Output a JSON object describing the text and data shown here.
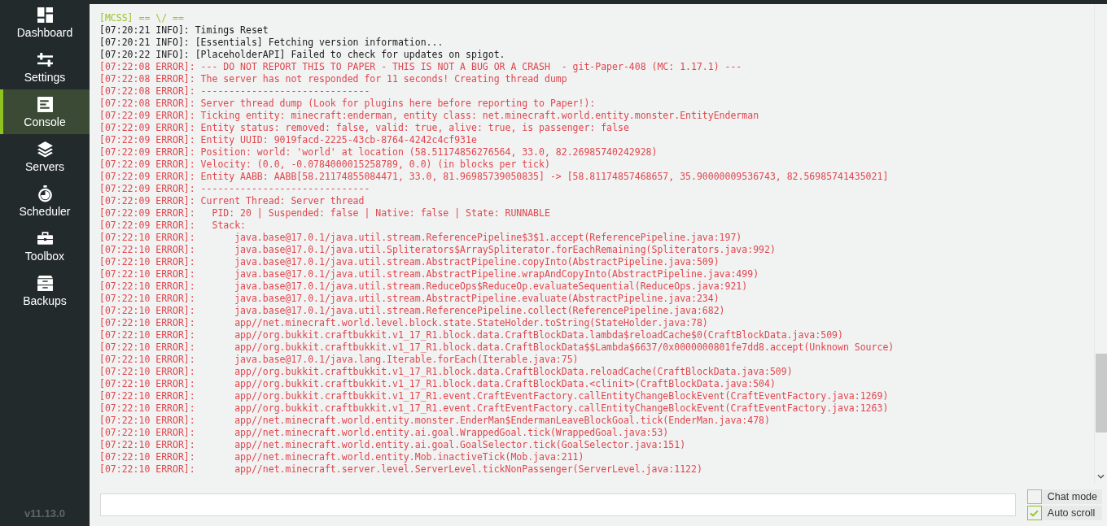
{
  "sidebar": {
    "items": [
      {
        "label": "Dashboard",
        "selected": false
      },
      {
        "label": "Settings",
        "selected": false
      },
      {
        "label": "Console",
        "selected": true
      },
      {
        "label": "Servers",
        "selected": false
      },
      {
        "label": "Scheduler",
        "selected": false
      },
      {
        "label": "Toolbox",
        "selected": false
      },
      {
        "label": "Backups",
        "selected": false
      }
    ],
    "version": "v11.13.0"
  },
  "console": {
    "lines": [
      {
        "kind": "mcss",
        "text": "[MCSS] == \\/ =="
      },
      {
        "kind": "info",
        "text": "[07:20:21 INFO]: Timings Reset"
      },
      {
        "kind": "info",
        "text": "[07:20:21 INFO]: [Essentials] Fetching version information..."
      },
      {
        "kind": "info",
        "text": "[07:20:22 INFO]: [PlaceholderAPI] Failed to check for updates on spigot."
      },
      {
        "kind": "error",
        "text": "[07:22:08 ERROR]: --- DO NOT REPORT THIS TO PAPER - THIS IS NOT A BUG OR A CRASH  - git-Paper-408 (MC: 1.17.1) ---"
      },
      {
        "kind": "error",
        "text": "[07:22:08 ERROR]: The server has not responded for 11 seconds! Creating thread dump"
      },
      {
        "kind": "error",
        "text": "[07:22:08 ERROR]: ------------------------------"
      },
      {
        "kind": "error",
        "text": "[07:22:08 ERROR]: Server thread dump (Look for plugins here before reporting to Paper!):"
      },
      {
        "kind": "error",
        "text": "[07:22:09 ERROR]: Ticking entity: minecraft:enderman, entity class: net.minecraft.world.entity.monster.EntityEnderman"
      },
      {
        "kind": "error",
        "text": "[07:22:09 ERROR]: Entity status: removed: false, valid: true, alive: true, is passenger: false"
      },
      {
        "kind": "error",
        "text": "[07:22:09 ERROR]: Entity UUID: 9019facd-2225-43cb-8764-4242c4cf931e"
      },
      {
        "kind": "error",
        "text": "[07:22:09 ERROR]: Position: world: 'world' at location (58.51174856276564, 33.0, 82.26985740242928)"
      },
      {
        "kind": "error",
        "text": "[07:22:09 ERROR]: Velocity: (0.0, -0.0784000015258789, 0.0) (in blocks per tick)"
      },
      {
        "kind": "error",
        "text": "[07:22:09 ERROR]: Entity AABB: AABB[58.21174855084471, 33.0, 81.96985739050835] -> [58.81174857468657, 35.90000009536743, 82.56985741435021]"
      },
      {
        "kind": "error",
        "text": "[07:22:09 ERROR]: ------------------------------"
      },
      {
        "kind": "error",
        "text": "[07:22:09 ERROR]: Current Thread: Server thread"
      },
      {
        "kind": "error",
        "text": "[07:22:09 ERROR]:   PID: 20 | Suspended: false | Native: false | State: RUNNABLE"
      },
      {
        "kind": "error",
        "text": "[07:22:09 ERROR]:   Stack:"
      },
      {
        "kind": "error",
        "text": "[07:22:10 ERROR]:       java.base@17.0.1/java.util.stream.ReferencePipeline$3$1.accept(ReferencePipeline.java:197)"
      },
      {
        "kind": "error",
        "text": "[07:22:10 ERROR]:       java.base@17.0.1/java.util.Spliterators$ArraySpliterator.forEachRemaining(Spliterators.java:992)"
      },
      {
        "kind": "error",
        "text": "[07:22:10 ERROR]:       java.base@17.0.1/java.util.stream.AbstractPipeline.copyInto(AbstractPipeline.java:509)"
      },
      {
        "kind": "error",
        "text": "[07:22:10 ERROR]:       java.base@17.0.1/java.util.stream.AbstractPipeline.wrapAndCopyInto(AbstractPipeline.java:499)"
      },
      {
        "kind": "error",
        "text": "[07:22:10 ERROR]:       java.base@17.0.1/java.util.stream.ReduceOps$ReduceOp.evaluateSequential(ReduceOps.java:921)"
      },
      {
        "kind": "error",
        "text": "[07:22:10 ERROR]:       java.base@17.0.1/java.util.stream.AbstractPipeline.evaluate(AbstractPipeline.java:234)"
      },
      {
        "kind": "error",
        "text": "[07:22:10 ERROR]:       java.base@17.0.1/java.util.stream.ReferencePipeline.collect(ReferencePipeline.java:682)"
      },
      {
        "kind": "error",
        "text": "[07:22:10 ERROR]:       app//net.minecraft.world.level.block.state.StateHolder.toString(StateHolder.java:78)"
      },
      {
        "kind": "error",
        "text": "[07:22:10 ERROR]:       app//org.bukkit.craftbukkit.v1_17_R1.block.data.CraftBlockData.lambda$reloadCache$0(CraftBlockData.java:509)"
      },
      {
        "kind": "error",
        "text": "[07:22:10 ERROR]:       app//org.bukkit.craftbukkit.v1_17_R1.block.data.CraftBlockData$$Lambda$6637/0x0000000801fe7dd8.accept(Unknown Source)"
      },
      {
        "kind": "error",
        "text": "[07:22:10 ERROR]:       java.base@17.0.1/java.lang.Iterable.forEach(Iterable.java:75)"
      },
      {
        "kind": "error",
        "text": "[07:22:10 ERROR]:       app//org.bukkit.craftbukkit.v1_17_R1.block.data.CraftBlockData.reloadCache(CraftBlockData.java:509)"
      },
      {
        "kind": "error",
        "text": "[07:22:10 ERROR]:       app//org.bukkit.craftbukkit.v1_17_R1.block.data.CraftBlockData.<clinit>(CraftBlockData.java:504)"
      },
      {
        "kind": "error",
        "text": "[07:22:10 ERROR]:       app//org.bukkit.craftbukkit.v1_17_R1.event.CraftEventFactory.callEntityChangeBlockEvent(CraftEventFactory.java:1269)"
      },
      {
        "kind": "error",
        "text": "[07:22:10 ERROR]:       app//org.bukkit.craftbukkit.v1_17_R1.event.CraftEventFactory.callEntityChangeBlockEvent(CraftEventFactory.java:1263)"
      },
      {
        "kind": "error",
        "text": "[07:22:10 ERROR]:       app//net.minecraft.world.entity.monster.EnderMan$EndermanLeaveBlockGoal.tick(EnderMan.java:478)"
      },
      {
        "kind": "error",
        "text": "[07:22:10 ERROR]:       app//net.minecraft.world.entity.ai.goal.WrappedGoal.tick(WrappedGoal.java:53)"
      },
      {
        "kind": "error",
        "text": "[07:22:10 ERROR]:       app//net.minecraft.world.entity.ai.goal.GoalSelector.tick(GoalSelector.java:151)"
      },
      {
        "kind": "error",
        "text": "[07:22:10 ERROR]:       app//net.minecraft.world.entity.Mob.inactiveTick(Mob.java:211)"
      },
      {
        "kind": "error",
        "text": "[07:22:10 ERROR]:       app//net.minecraft.server.level.ServerLevel.tickNonPassenger(ServerLevel.java:1122)"
      }
    ]
  },
  "options": [
    {
      "label": "Chat mode",
      "checked": false
    },
    {
      "label": "Auto scroll",
      "checked": true
    }
  ]
}
